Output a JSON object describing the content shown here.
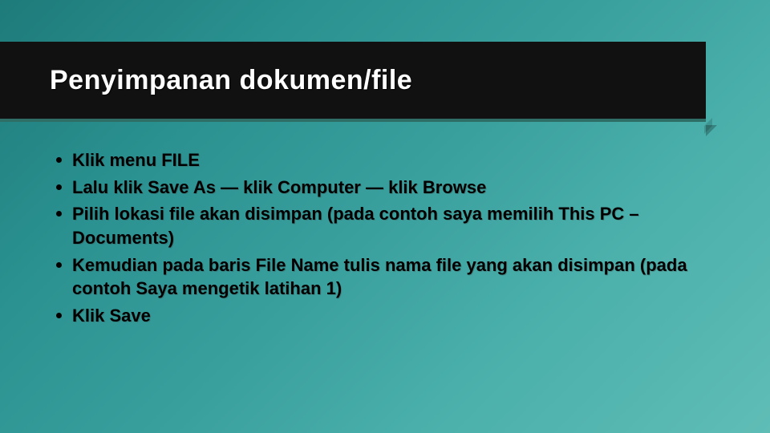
{
  "slide": {
    "title": "Penyimpanan dokumen/file",
    "bullets": [
      "Klik menu FILE",
      "Lalu klik Save As — klik Computer — klik Browse",
      "Pilih lokasi file akan disimpan (pada contoh saya memilih This PC – Documents)",
      "Kemudian pada baris File Name tulis nama file yang akan disimpan (pada contoh Saya mengetik latihan 1)",
      "Klik Save"
    ]
  }
}
